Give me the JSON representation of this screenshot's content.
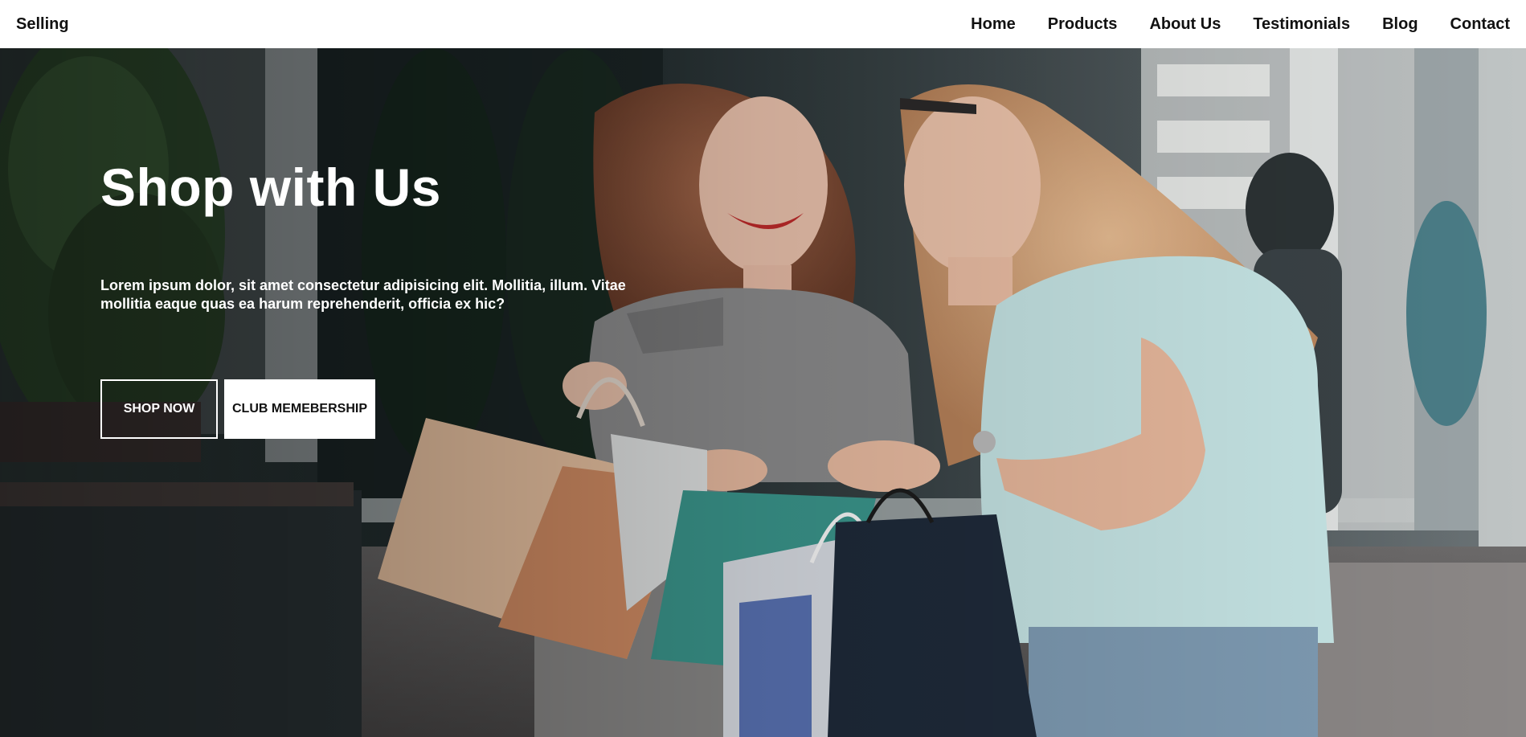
{
  "header": {
    "brand": "Selling",
    "nav": [
      "Home",
      "Products",
      "About Us",
      "Testimonials",
      "Blog",
      "Contact"
    ]
  },
  "hero": {
    "title": "Shop with Us",
    "text": "Lorem ipsum dolor, sit amet consectetur adipisicing elit. Mollitia, illum. Vitae mollitia eaque quas ea harum reprehenderit, officia ex hic?",
    "primary_button": "SHOP NOW",
    "secondary_button": "CLUB MEMEBERSHIP"
  },
  "colors": {
    "nav_bg": "#ffffff",
    "hero_text": "#ffffff",
    "button_solid_bg": "#ffffff"
  }
}
